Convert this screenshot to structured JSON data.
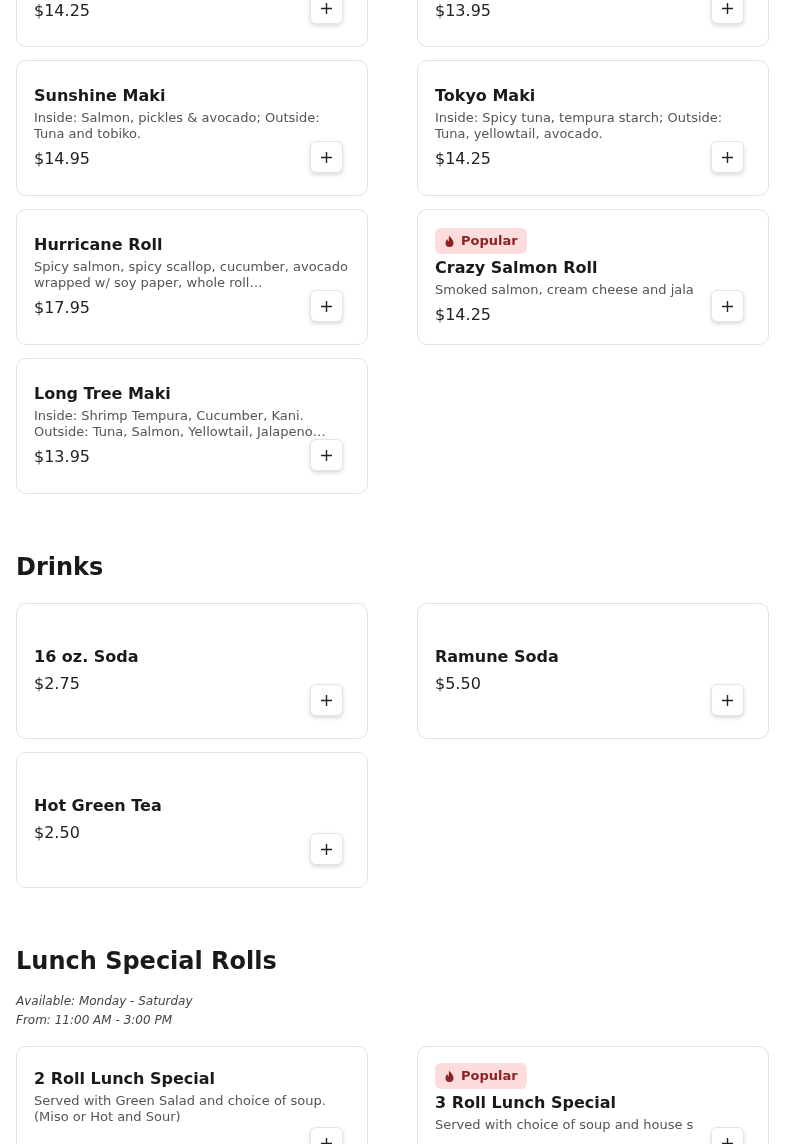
{
  "sections": [
    {
      "items": [
        {
          "price": "$14.25",
          "popular": false
        },
        {
          "price": "$13.95",
          "popular": false
        },
        {
          "name": "Sunshine Maki",
          "description": "Inside: Salmon, pickles & avocado; Outside: Tuna and tobiko.",
          "price": "$14.95",
          "popular": false
        },
        {
          "name": "Tokyo Maki",
          "description": "Inside: Spicy tuna, tempura starch; Outside: Tuna, yellowtail, avocado.",
          "price": "$14.25",
          "popular": false
        },
        {
          "name": "Hurricane Roll",
          "description": "Spicy salmon, spicy scallop, cucumber, avocado wrapped w/ soy paper, whole roll…",
          "price": "$17.95",
          "popular": false
        },
        {
          "badge": "Popular",
          "name": "Crazy Salmon Roll",
          "description": "Smoked salmon, cream cheese and jala",
          "price": "$14.25",
          "popular": true
        },
        {
          "name": "Long Tree Maki",
          "description": "Inside: Shrimp Tempura, Cucumber, Kani. Outside: Tuna, Salmon, Yellowtail, Jalapeno…",
          "price": "$13.95",
          "popular": false
        }
      ]
    },
    {
      "title": "Drinks",
      "items": [
        {
          "name": "16 oz. Soda",
          "price": "$2.75",
          "popular": false
        },
        {
          "name": "Ramune Soda",
          "price": "$5.50",
          "popular": false
        },
        {
          "name": "Hot Green Tea",
          "price": "$2.50",
          "popular": false
        }
      ]
    },
    {
      "title": "Lunch Special Rolls",
      "notes": [
        "Available: Monday - Saturday",
        "From: 11:00 AM - 3:00 PM"
      ],
      "items": [
        {
          "name": "2 Roll Lunch Special",
          "description": "Served with Green Salad and choice of soup. (Miso or Hot and Sour)",
          "popular": false
        },
        {
          "badge": "Popular",
          "name": "3 Roll Lunch Special",
          "description": "Served with choice of soup and house s",
          "popular": true
        }
      ]
    }
  ]
}
